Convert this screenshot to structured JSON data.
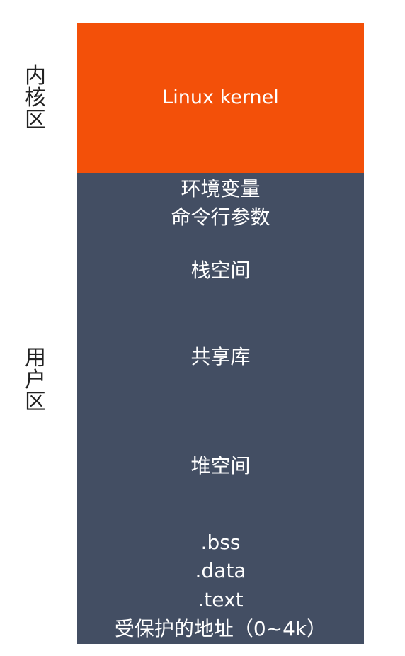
{
  "labels": {
    "kernel_zone": "内\n核\n区",
    "user_zone": "用\n户\n区"
  },
  "kernel": {
    "text": "Linux kernel",
    "color": "#f35009"
  },
  "user_space": {
    "color": "#434e63",
    "env": "环境变量",
    "args": "命令行参数",
    "stack": "栈空间",
    "shared_lib": "共享库",
    "heap": "堆空间",
    "bss": ".bss",
    "data": ".data",
    "text": ".text",
    "protected": "受保护的地址（0~4k）"
  }
}
